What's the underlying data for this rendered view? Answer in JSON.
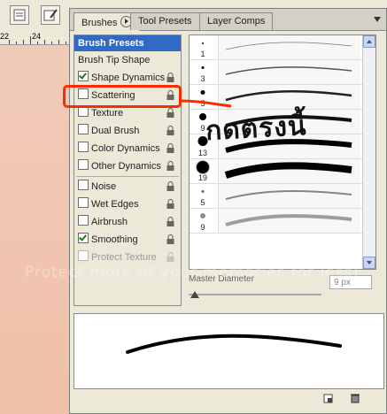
{
  "ruler": {
    "labels": [
      "22",
      "24"
    ]
  },
  "tabs": [
    {
      "label": "Brushes",
      "active": true
    },
    {
      "label": "Tool Presets",
      "active": false
    },
    {
      "label": "Layer Comps",
      "active": false
    }
  ],
  "options": {
    "header": "Brush Presets",
    "brush_tip_shape": "Brush Tip Shape",
    "items_top": [
      {
        "label": "Shape Dynamics",
        "checked": true
      },
      {
        "label": "Scattering",
        "checked": false
      },
      {
        "label": "Texture",
        "checked": false
      },
      {
        "label": "Dual Brush",
        "checked": false
      },
      {
        "label": "Color Dynamics",
        "checked": false
      },
      {
        "label": "Other Dynamics",
        "checked": false
      }
    ],
    "items_bottom": [
      {
        "label": "Noise",
        "checked": false
      },
      {
        "label": "Wet Edges",
        "checked": false
      },
      {
        "label": "Airbrush",
        "checked": false
      },
      {
        "label": "Smoothing",
        "checked": true
      },
      {
        "label": "Protect Texture",
        "checked": false,
        "disabled": true
      }
    ]
  },
  "brushes": [
    {
      "size": "1"
    },
    {
      "size": "3"
    },
    {
      "size": "5"
    },
    {
      "size": "9"
    },
    {
      "size": "13"
    },
    {
      "size": "19"
    },
    {
      "size": "5"
    },
    {
      "size": "9"
    }
  ],
  "master_diameter": {
    "label": "Master Diameter",
    "value": "9 px"
  },
  "annotation": {
    "text": "กดตรงนี้",
    "color": "#ff2b00"
  },
  "watermark": "Protect more of your memories for less!"
}
